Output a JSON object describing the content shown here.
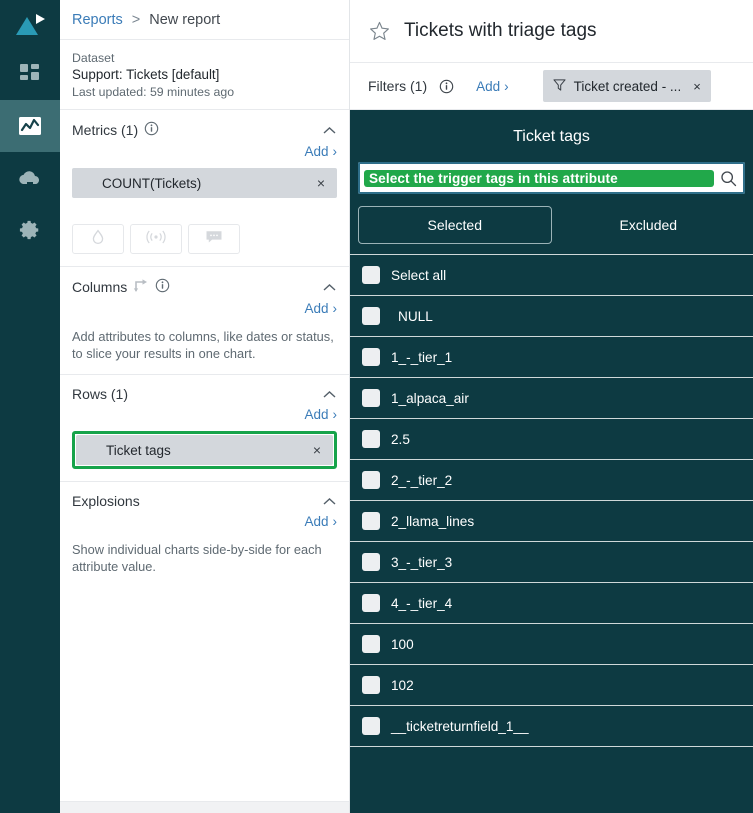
{
  "rail": {
    "logo_name": "app-logo",
    "items": [
      {
        "name": "dashboard-icon",
        "active": false
      },
      {
        "name": "analytics-chart-icon",
        "active": true
      },
      {
        "name": "cloud-upload-icon",
        "active": false
      },
      {
        "name": "settings-gear-icon",
        "active": false
      }
    ]
  },
  "breadcrumb": {
    "root": "Reports",
    "separator": ">",
    "current": "New report"
  },
  "dataset": {
    "label": "Dataset",
    "name": "Support: Tickets [default]",
    "updated": "Last updated: 59 minutes ago"
  },
  "metrics": {
    "title": "Metrics (1)",
    "add_label": "Add",
    "add_chevron": "›",
    "chips": [
      {
        "label": "COUNT(Tickets)",
        "remove": "×"
      }
    ],
    "action_icons": [
      "droplet-icon",
      "broadcast-signal-icon",
      "comment-bubble-icon"
    ]
  },
  "columns": {
    "title": "Columns",
    "add_label": "Add",
    "add_chevron": "›",
    "help": "Add attributes to columns, like dates or status, to slice your results in one chart."
  },
  "rows": {
    "title": "Rows (1)",
    "add_label": "Add",
    "add_chevron": "›",
    "chips": [
      {
        "label": "Ticket tags",
        "remove": "×",
        "highlighted": true
      }
    ]
  },
  "explosions": {
    "title": "Explosions",
    "add_label": "Add",
    "add_chevron": "›",
    "help": "Show individual charts side-by-side for each attribute value."
  },
  "report": {
    "title": "Tickets with triage tags",
    "star_icon": "favorite-star-icon"
  },
  "filters": {
    "label": "Filters (1)",
    "add_label": "Add",
    "add_chevron": "›",
    "chips": [
      {
        "label": "Ticket created - ...",
        "remove": "×",
        "icon": "funnel-filter-icon"
      }
    ]
  },
  "picker": {
    "title": "Ticket tags",
    "search_placeholder": "Select the trigger tags in this attribute",
    "search_icon": "search-magnifier-icon",
    "tabs": [
      {
        "label": "Selected",
        "selected": true
      },
      {
        "label": "Excluded",
        "selected": false
      }
    ],
    "rows": [
      {
        "label": "Select all",
        "checked": false,
        "indent": false
      },
      {
        "label": "NULL",
        "checked": false,
        "indent": true
      },
      {
        "label": "1_-_tier_1",
        "checked": false,
        "indent": false
      },
      {
        "label": "1_alpaca_air",
        "checked": false,
        "indent": false
      },
      {
        "label": "2.5",
        "checked": false,
        "indent": false
      },
      {
        "label": "2_-_tier_2",
        "checked": false,
        "indent": false
      },
      {
        "label": "2_llama_lines",
        "checked": false,
        "indent": false
      },
      {
        "label": "3_-_tier_3",
        "checked": false,
        "indent": false
      },
      {
        "label": "4_-_tier_4",
        "checked": false,
        "indent": false
      },
      {
        "label": "100",
        "checked": false,
        "indent": false
      },
      {
        "label": "102",
        "checked": false,
        "indent": false
      },
      {
        "label": "__ticketreturnfield_1__",
        "checked": false,
        "indent": false
      }
    ]
  },
  "colors": {
    "rail_bg": "#0d3a42",
    "rail_active": "#3c6d73",
    "panel_dark": "#0d3a42",
    "link_blue": "#3b7cb8",
    "highlight_green": "#16a34a",
    "search_highlight_green": "#21a84a",
    "chip_gray": "#d3d7dc"
  }
}
